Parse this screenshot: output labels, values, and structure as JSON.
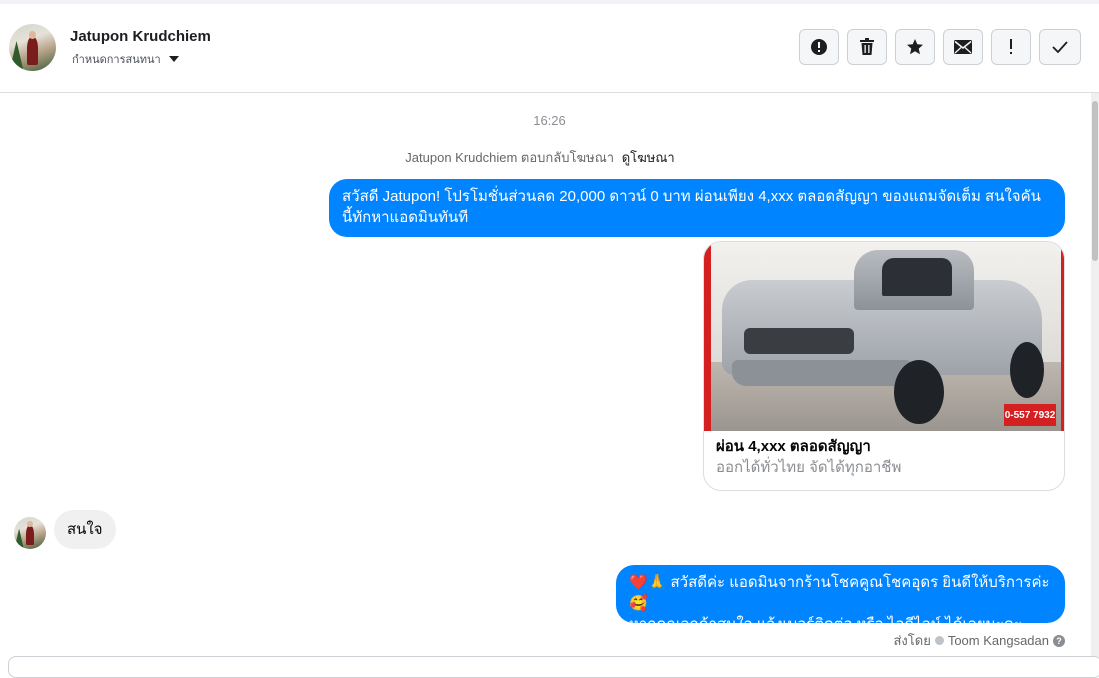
{
  "header": {
    "contact_name": "Jatupon Krudchiem",
    "assign_label": "กำหนดการสนทนา",
    "action_icons": [
      "alert-icon",
      "trash-icon",
      "star-icon",
      "envelope-icon",
      "exclamation-icon",
      "check-icon"
    ]
  },
  "thread": {
    "timestamp": "16:26",
    "context_text": "Jatupon Krudchiem ตอบกลับโฆษณา",
    "context_link": "ดูโฆษณา",
    "messages": [
      {
        "direction": "outgoing",
        "text_line1": "สวัสดี Jatupon! โปรโมชั่นส่วนลด 20,000 ดาวน์ 0 บาท ผ่อนเพียง 4,xxx ตลอดสัญญา ของแถมจัดเต็ม สนใจคัน",
        "text_line2": "นี้ทักหาแอดมินทันที"
      },
      {
        "direction": "outgoing",
        "card_title": "ผ่อน 4,xxx ตลอดสัญญา",
        "card_subtitle": "ออกได้ทั่วไทย จัดได้ทุกอาชีพ",
        "card_image_text": "0-557 7932"
      },
      {
        "direction": "incoming",
        "text": "สนใจ"
      },
      {
        "direction": "outgoing",
        "text_line1": "❤️🙏 สวัสดีค่ะ แอดมินจากร้านโชคคูณโชคอุดร ยินดีให้บริการค่ะ🥰",
        "text_line2": "หากคุณลูกค้าสนใจ แจ้งเบอร์ติดต่อ หรือ ไอดีไลน์ ได้เลยนะคะ"
      }
    ],
    "sent_by_label": "ส่งโดย",
    "sent_by_name": "Toom Kangsadan"
  },
  "colors": {
    "outgoing_bubble": "#0084ff",
    "incoming_bubble": "#f0f0f0"
  }
}
